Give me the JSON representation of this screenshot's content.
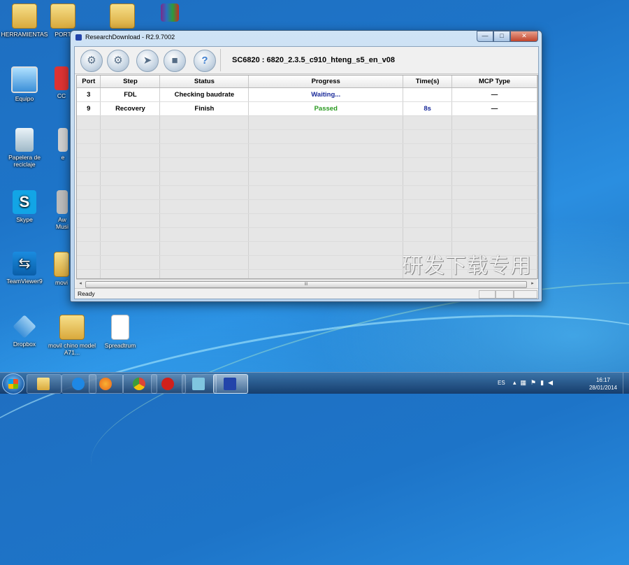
{
  "desktop": {
    "icons": [
      {
        "label": "HERRAMIENTAS",
        "icon": "folder-icon"
      },
      {
        "label": "PORT",
        "icon": "folder-icon"
      },
      {
        "label": "Equipo",
        "icon": "computer-icon"
      },
      {
        "label": "CC",
        "icon": "shortcut-icon"
      },
      {
        "label": "Papelera de reciclaje",
        "icon": "recycle-bin-icon"
      },
      {
        "label": "e",
        "icon": "shortcut-icon"
      },
      {
        "label": "Skype",
        "icon": "skype-icon"
      },
      {
        "label": "Aw Musi",
        "icon": "shortcut-icon"
      },
      {
        "label": "TeamViewer9",
        "icon": "teamviewer-icon"
      },
      {
        "label": "movi",
        "icon": "folder-icon"
      },
      {
        "label": "Dropbox",
        "icon": "dropbox-icon"
      },
      {
        "label": "movil chino model A71...",
        "icon": "folder-icon"
      },
      {
        "label": "Spreadtrum",
        "icon": "document-icon"
      }
    ],
    "watermark": "研发下载专用"
  },
  "window": {
    "title": "ResearchDownload - R2.9.7002",
    "controls": {
      "minimize": "—",
      "maximize": "□",
      "close": "✕"
    },
    "toolbar": {
      "buttons": [
        {
          "name": "settings-gear",
          "glyph": "⚙"
        },
        {
          "name": "load-packet",
          "glyph": "⚙"
        },
        {
          "name": "start-download",
          "glyph": "➤"
        },
        {
          "name": "stop-download",
          "glyph": "■"
        },
        {
          "name": "help",
          "glyph": "?"
        }
      ],
      "device_label": "SC6820 : 6820_2.3.5_c910_hteng_s5_en_v08"
    },
    "table": {
      "columns": [
        "Port",
        "Step",
        "Status",
        "Progress",
        "Time(s)",
        "MCP Type"
      ],
      "rows": [
        {
          "port": "3",
          "step": "FDL",
          "status": "Checking baudrate",
          "progress": "Waiting...",
          "time": "",
          "mcp": "—"
        },
        {
          "port": "9",
          "step": "Recovery",
          "status": "Finish",
          "progress": "Passed",
          "time": "8s",
          "mcp": "—"
        }
      ]
    },
    "scrollbar": {
      "left": "◂",
      "right": "▸",
      "thumb": "III"
    },
    "statusbar": {
      "text": "Ready"
    }
  },
  "taskbar": {
    "language": "ES",
    "time": "16:17",
    "date": "28/01/2014",
    "items": [
      "explorer",
      "internet-explorer",
      "firefox",
      "chrome",
      "opera",
      "notepad",
      "research-download"
    ],
    "colors": {
      "ie": "#1e88e5",
      "firefox": "#e8641b",
      "chrome": "#3c9b3c",
      "opera": "#d0201b",
      "notepad": "#7fc6e0",
      "rd": "#2244aa"
    }
  }
}
